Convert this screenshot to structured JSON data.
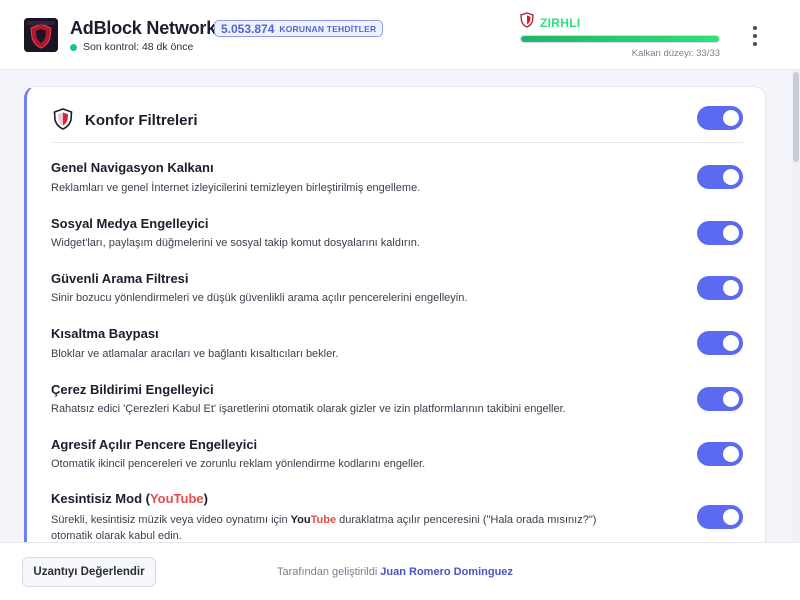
{
  "header": {
    "app_title": "AdBlock Network",
    "threat_count": "5.053.874",
    "threat_label": "KORUNAN TEHDİTLER",
    "last_check": "Son kontrol: 48 dk önce",
    "shield_status": "ZIRHLI",
    "shield_level_text": "Kalkan düzeyi: 33/33",
    "shield_level_value": 1.0,
    "status_color": "#2ee07a",
    "menu_icon": "kebab-menu-icon"
  },
  "card": {
    "title": "Konfor Filtreleri",
    "master_toggle": true,
    "accent_color": "#5b6af0",
    "filters": [
      {
        "title": "Genel Navigasyon Kalkanı",
        "description": "Reklamları ve genel İnternet izleyicilerini temizleyen birleştirilmiş engelleme.",
        "enabled": true
      },
      {
        "title": "Sosyal Medya Engelleyici",
        "description": "Widget'ları, paylaşım düğmelerini ve sosyal takip komut dosyalarını kaldırın.",
        "enabled": true
      },
      {
        "title": "Güvenli Arama Filtresi",
        "description": "Sinir bozucu yönlendirmeleri ve düşük güvenlikli arama açılır pencerelerini engelleyin.",
        "enabled": true
      },
      {
        "title": "Kısaltma Baypası",
        "description": "Bloklar ve atlamalar aracıları ve bağlantı kısaltıcıları bekler.",
        "enabled": true
      },
      {
        "title": "Çerez Bildirimi Engelleyici",
        "description": "Rahatsız edici 'Çerezleri Kabul Et' işaretlerini otomatik olarak gizler ve izin platformlarının takibini engeller.",
        "enabled": true
      },
      {
        "title": "Agresif Açılır Pencere Engelleyici",
        "description": "Otomatik ikincil pencereleri ve zorunlu reklam yönlendirme kodlarını engeller.",
        "enabled": true
      },
      {
        "title_prefix": "Kesintisiz Mod (",
        "title_you": "You",
        "title_tube": "Tube",
        "title_suffix": ")",
        "desc_prefix": "Sürekli, kesintisiz müzik veya video oynatımı için ",
        "desc_you": "You",
        "desc_tube": "Tube",
        "desc_suffix": " duraklatma açılır penceresini (\"Hala orada mısınız?\") otomatik olarak kabul edin.",
        "enabled": true
      }
    ]
  },
  "footer": {
    "rate_button": "Uzantıyı Değerlendir",
    "credit_prefix": "Tarafından geliştirildi",
    "developer": "Juan Romero Dominguez"
  }
}
